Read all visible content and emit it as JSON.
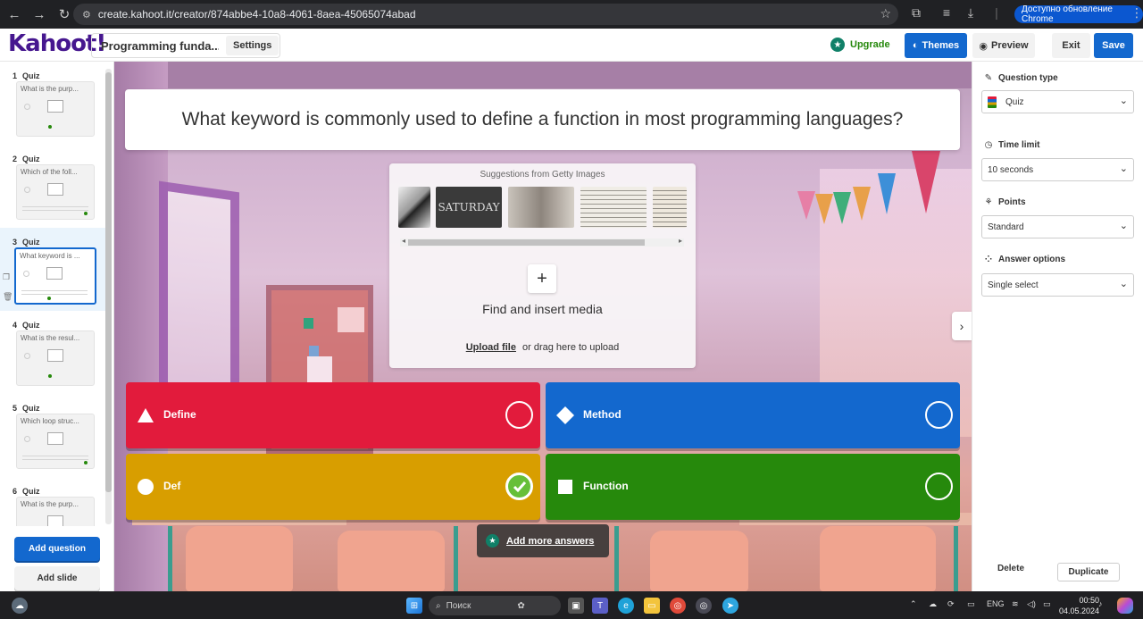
{
  "browser": {
    "url": "create.kahoot.it/creator/874abbe4-10a8-4061-8aea-45065074abad",
    "update_label": "Доступно обновление Chrome"
  },
  "header": {
    "logo": "Kahoot!",
    "kahoot_title": "Programming funda...",
    "settings_label": "Settings",
    "upgrade_label": "Upgrade",
    "themes_label": "Themes",
    "preview_label": "Preview",
    "exit_label": "Exit",
    "save_label": "Save"
  },
  "sidebar": {
    "slides": [
      {
        "num": "1",
        "type": "Quiz",
        "text": "What is the purp..."
      },
      {
        "num": "2",
        "type": "Quiz",
        "text": "Which of the foll..."
      },
      {
        "num": "3",
        "type": "Quiz",
        "text": "What keyword is ..."
      },
      {
        "num": "4",
        "type": "Quiz",
        "text": "What is the resul..."
      },
      {
        "num": "5",
        "type": "Quiz",
        "text": "Which loop struc..."
      },
      {
        "num": "6",
        "type": "Quiz",
        "text": "What is the purp..."
      }
    ],
    "add_question_label": "Add question",
    "add_slide_label": "Add slide"
  },
  "canvas": {
    "question": "What keyword is commonly used to define a function in most programming languages?",
    "media": {
      "getty_title": "Suggestions from Getty Images",
      "find_media_label": "Find and insert media",
      "upload_link": "Upload file",
      "upload_rest": "or drag here to upload"
    },
    "answers": [
      {
        "label": "Define",
        "color": "#e21b3c",
        "shape": "triangle",
        "correct": false
      },
      {
        "label": "Method",
        "color": "#1368ce",
        "shape": "diamond",
        "correct": false
      },
      {
        "label": "Def",
        "color": "#d89e00",
        "shape": "circle",
        "correct": true
      },
      {
        "label": "Function",
        "color": "#26890c",
        "shape": "square",
        "correct": false
      }
    ],
    "add_more_label": "Add more answers"
  },
  "right_panel": {
    "question_type_label": "Question type",
    "question_type_value": "Quiz",
    "time_limit_label": "Time limit",
    "time_limit_value": "10 seconds",
    "points_label": "Points",
    "points_value": "Standard",
    "answer_options_label": "Answer options",
    "answer_options_value": "Single select",
    "delete_label": "Delete",
    "duplicate_label": "Duplicate"
  },
  "taskbar": {
    "search_placeholder": "Поиск",
    "lang": "ENG",
    "time": "00:50",
    "date": "04.05.2024"
  }
}
